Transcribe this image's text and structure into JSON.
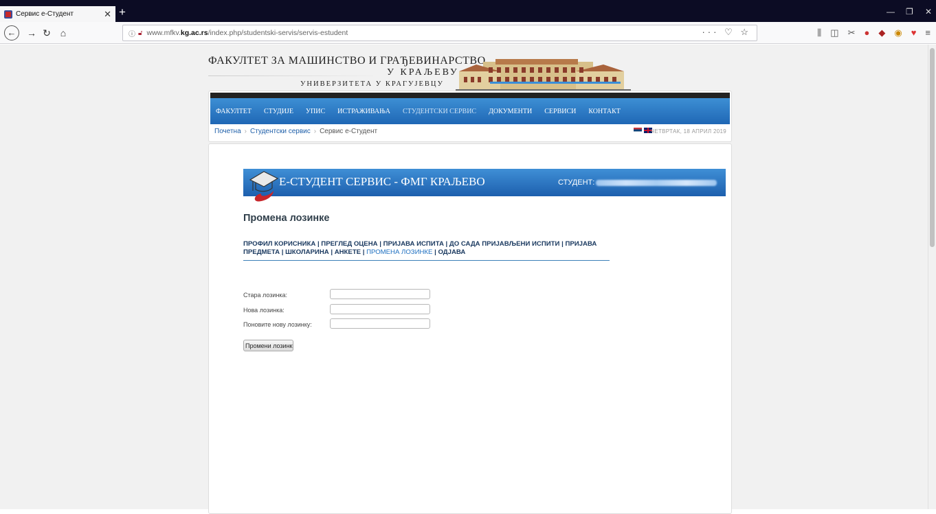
{
  "browser": {
    "tab_title": "Сервис е-Студент",
    "url_prefix": "www.mfkv.",
    "url_domain": "kg.ac.rs",
    "url_path": "/index.php/studentski-servis/servis-estudent"
  },
  "header": {
    "line1": "ФАКУЛТЕТ ЗА МАШИНСТВО И ГРАЂЕВИНАРСТВО",
    "line2": "У КРАЉЕВУ",
    "line3": "УНИВЕРЗИТЕТА У КРАГУЈЕВЦУ"
  },
  "menu": {
    "items": [
      "ФАКУЛТЕТ",
      "СТУДИЈЕ",
      "УПИС",
      "ИСТРАЖИВАЊА",
      "СТУДЕНТСКИ СЕРВИС",
      "ДОКУМЕНТИ",
      "СЕРВИСИ",
      "КОНТАКТ"
    ],
    "active_index": 4
  },
  "breadcrumb": {
    "items": [
      "Почетна",
      "Студентски сервис",
      "Сервис е-Студент"
    ],
    "date": "ЧЕТВРТАК, 18 АПРИЛ 2019"
  },
  "estudent": {
    "title": "Е-СТУДЕНТ СЕРВИС - ФМГ КРАЉЕВО",
    "student_label": "СТУДЕНТ:"
  },
  "page_title": "Промена лозинке",
  "links": [
    "ПРОФИЛ КОРИСНИКА",
    "ПРЕГЛЕД ОЦЕНА",
    "ПРИЈАВА ИСПИТА",
    "ДО САДА ПРИЈАВЉЕНИ ИСПИТИ",
    "ПРИЈАВА ПРЕДМЕТА",
    "ШКОЛАРИНА",
    "АНКЕТЕ",
    "ПРОМЕНА ЛОЗИНКЕ",
    "ОДЈАВА"
  ],
  "form": {
    "old_password_label": "Стара лозинка:",
    "new_password_label": "Нова лозинка:",
    "repeat_password_label": "Поновите нову лозинку:",
    "submit_label": "Промени лозинку"
  },
  "colors": {
    "menu_blue": "#2a78c6",
    "chrome_dark": "#0c0c24",
    "link_dark": "#1b3a60"
  }
}
